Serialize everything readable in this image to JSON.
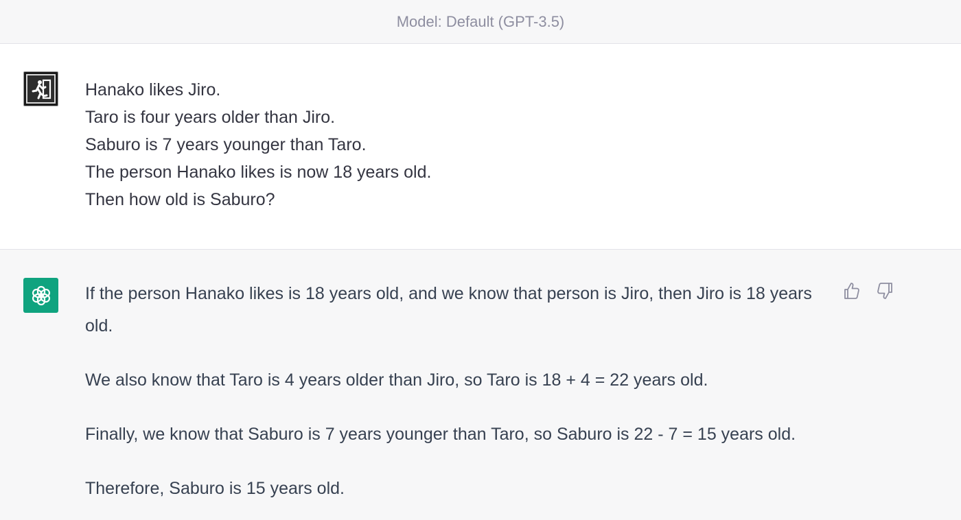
{
  "header": {
    "model_label": "Model: Default (GPT-3.5)"
  },
  "user_message": {
    "avatar_icon": "exit-running-man-icon",
    "lines": [
      "Hanako likes Jiro.",
      "Taro is four years older than Jiro.",
      "Saburo is 7 years younger than Taro.",
      "The person Hanako likes is now 18 years old.",
      "Then how old is Saburo?"
    ]
  },
  "assistant_message": {
    "avatar_icon": "openai-logo-icon",
    "avatar_color": "#10a37f",
    "paragraphs": [
      "If the person Hanako likes is 18 years old, and we know that person is Jiro, then Jiro is 18 years old.",
      "We also know that Taro is 4 years older than Jiro, so Taro is 18 + 4 = 22 years old.",
      "Finally, we know that Saburo is 7 years younger than Taro, so Saburo is 22 - 7 = 15 years old.",
      "Therefore, Saburo is 15 years old."
    ],
    "feedback": {
      "thumbs_up_icon": "thumbs-up-icon",
      "thumbs_down_icon": "thumbs-down-icon"
    }
  }
}
